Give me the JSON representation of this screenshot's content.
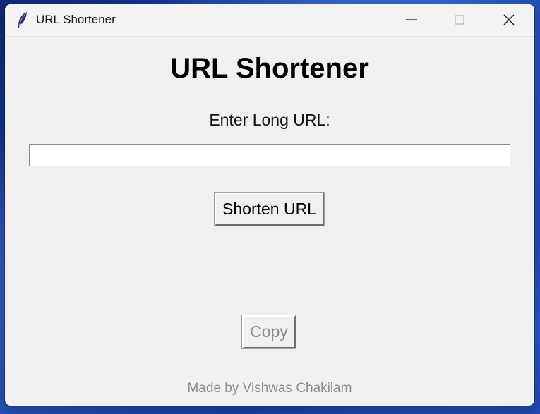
{
  "window": {
    "title": "URL Shortener",
    "app_icon": "feather-icon"
  },
  "controls": {
    "minimize_icon": "minimize-icon",
    "maximize_icon": "maximize-icon",
    "close_icon": "close-icon"
  },
  "main": {
    "heading": "URL Shortener",
    "input_label": "Enter Long URL:",
    "url_input": {
      "value": "",
      "placeholder": ""
    },
    "shorten_button": "Shorten URL",
    "copy_button": "Copy",
    "footer": "Made by Vishwas Chakilam"
  },
  "colors": {
    "window_bg": "#f0f0f0",
    "disabled_text": "#8a8a8a",
    "footer_text": "#8c8c8c"
  }
}
